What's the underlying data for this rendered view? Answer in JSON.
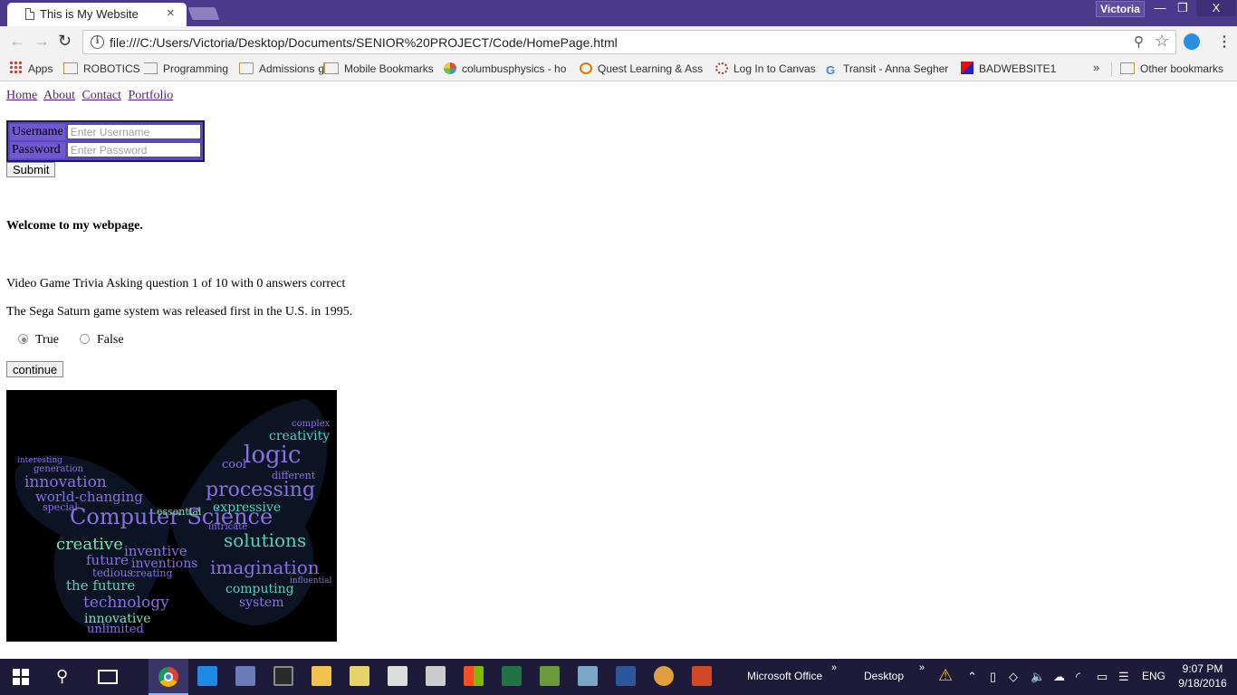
{
  "browser": {
    "tab_title": "This is My Website",
    "tab_close": "×",
    "profile_name": "Victoria",
    "window_controls": {
      "minimize": "—",
      "maximize": "❐",
      "close": "X"
    },
    "url": "file:///C:/Users/Victoria/Desktop/Documents/SENIOR%20PROJECT/Code/HomePage.html",
    "bookmarks": [
      {
        "label": "Apps",
        "icon": "apps-grid-icon"
      },
      {
        "label": "ROBOTICS",
        "icon": "folder-icon"
      },
      {
        "label": "Programming",
        "icon": "folder-icon"
      },
      {
        "label": "Admissions",
        "icon": "folder-icon"
      },
      {
        "label": "Mobile Bookmarks",
        "icon": "folder-icon"
      },
      {
        "label": "columbusphysics - ho",
        "icon": "pinwheel-icon"
      },
      {
        "label": "Quest Learning & Ass",
        "icon": "quest-icon"
      },
      {
        "label": "Log In to Canvas",
        "icon": "canvas-icon"
      },
      {
        "label": "Transit - Anna Segher",
        "icon": "google-icon"
      },
      {
        "label": "BADWEBSITE1",
        "icon": "badwebsite-icon"
      }
    ],
    "bookmarks_more": "»",
    "other_bookmarks": "Other bookmarks"
  },
  "page": {
    "nav": [
      "Home",
      "About",
      "Contact",
      "Portfolio"
    ],
    "login": {
      "username_label": "Username",
      "username_placeholder": "Enter Username",
      "password_label": "Password",
      "password_placeholder": "Enter Password",
      "submit_label": "Submit"
    },
    "welcome": "Welcome to my webpage.",
    "trivia": {
      "status": "Video Game Trivia Asking question 1 of 10 with 0 answers correct",
      "question": "The Sega Saturn game system was released first in the U.S. in 1995.",
      "options": [
        {
          "label": "True",
          "checked": true
        },
        {
          "label": "False",
          "checked": false
        }
      ],
      "continue_label": "continue"
    },
    "wordcloud_words": [
      "Computer Science",
      "logic",
      "processing",
      "imagination",
      "solutions",
      "innovation",
      "creative",
      "the future",
      "technology",
      "innovative",
      "world-changing",
      "expressive",
      "creativity",
      "inventive",
      "inventions",
      "future",
      "computing",
      "system",
      "unlimited",
      "essential",
      "tedious",
      "creating",
      "cool",
      "different",
      "generation",
      "special",
      "influential",
      "intricate",
      "interesting",
      "complex"
    ]
  },
  "taskbar": {
    "office_label": "Microsoft Office",
    "desktop_label": "Desktop",
    "language": "ENG",
    "time": "9:07 PM",
    "date": "9/18/2016"
  }
}
